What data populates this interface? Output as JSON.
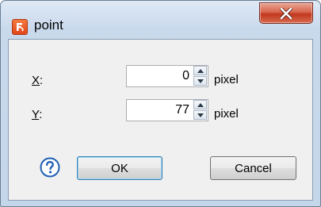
{
  "window": {
    "title": "point",
    "icon": "app-logo-icon",
    "close_icon": "close-icon"
  },
  "fields": [
    {
      "label_prefix": "",
      "label_mnemonic": "X",
      "label_suffix": ":",
      "value": "0",
      "unit": "pixel"
    },
    {
      "label_prefix": "",
      "label_mnemonic": "Y",
      "label_suffix": ":",
      "value": "77",
      "unit": "pixel"
    }
  ],
  "buttons": {
    "help_icon": "help-icon",
    "ok_label": "OK",
    "cancel_label": "Cancel"
  },
  "colors": {
    "accent": "#3c7fb1",
    "close": "#c0391f",
    "app_icon": "#e0461a",
    "help": "#1e5fb4"
  }
}
